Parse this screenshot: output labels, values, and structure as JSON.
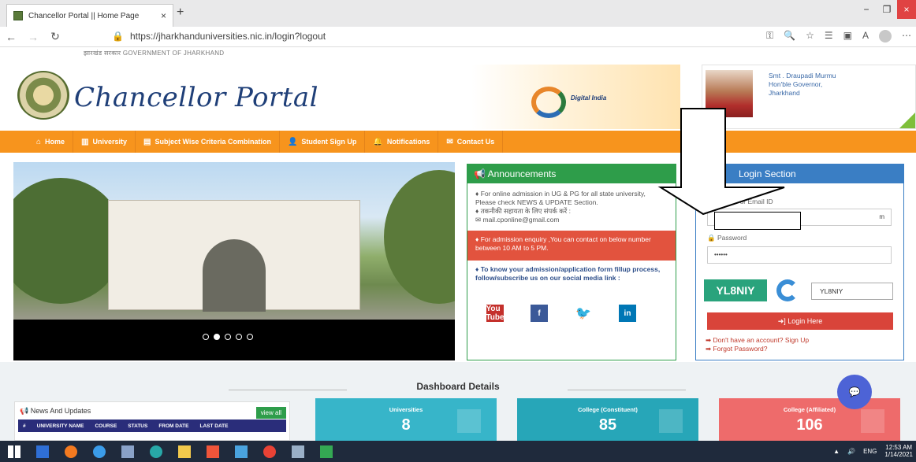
{
  "browser": {
    "tab_title": "Chancellor Portal || Home Page",
    "tab_close": "×",
    "new_tab": "+",
    "url": "https://jharkhanduniversities.nic.in/login?logout",
    "win_min": "−",
    "win_max": "❐",
    "win_close": "×"
  },
  "header": {
    "gov_text": "झारखंड सरकार   GOVERNMENT OF JHARKHAND",
    "brand": "Chancellor Portal",
    "digital_india": "Digital India",
    "governor_name": "Smt . Draupadi Murmu",
    "governor_title": "Hon'ble Governor,",
    "governor_state": "Jharkhand"
  },
  "nav": {
    "items": [
      {
        "label": "Home",
        "icon": "⌂"
      },
      {
        "label": "University",
        "icon": "▥"
      },
      {
        "label": "Subject Wise Criteria Combination",
        "icon": "▤"
      },
      {
        "label": "Student Sign Up",
        "icon": "👤"
      },
      {
        "label": "Notifications",
        "icon": "🔔"
      },
      {
        "label": "Contact Us",
        "icon": "✉"
      }
    ]
  },
  "announcements": {
    "title": "Announcements",
    "line1": "♦ For online admission in UG & PG for all state university, Please check NEWS & UPDATE Section.",
    "line2": "♦ तकनीकी सहायता के लिए संपर्क करें :",
    "email": "✉ mail.cponline@gmail.com",
    "red_text": "♦ For admission enquiry ,You can contact on below number between 10 AM to 5 PM.",
    "social_text": "♦ To know your admission/application form fillup process, follow/subscribe us on our social media link :",
    "social": [
      "You Tube",
      "f",
      "🐦",
      "in"
    ]
  },
  "login": {
    "title": "Login Section",
    "username_label": "Username or Email ID",
    "username_value": "m",
    "password_label": "🔒 Password",
    "password_value": "••••••",
    "captcha": "YL8NIY",
    "captcha_input": "YL8NIY",
    "button": "➜] Login Here",
    "signup": "➡ Don't have an account? Sign Up",
    "forgot": "➡ Forgot Password?"
  },
  "dashboard": {
    "title": "Dashboard Details",
    "news_title": "News And Updates",
    "view_all": "view all",
    "table_headers": [
      "#",
      "UNIVERSITY NAME",
      "COURSE",
      "STATUS",
      "FROM DATE",
      "LAST DATE"
    ],
    "cards": [
      {
        "label": "Universities",
        "value": "8",
        "color": "#37b5c9"
      },
      {
        "label": "College (Constituent)",
        "value": "85",
        "color": "#27a6b8"
      },
      {
        "label": "College (Affiliated)",
        "value": "106",
        "color": "#ee6b6b"
      }
    ]
  },
  "taskbar": {
    "lang": "ENG",
    "time": "12:53 AM",
    "date": "1/14/2021"
  }
}
